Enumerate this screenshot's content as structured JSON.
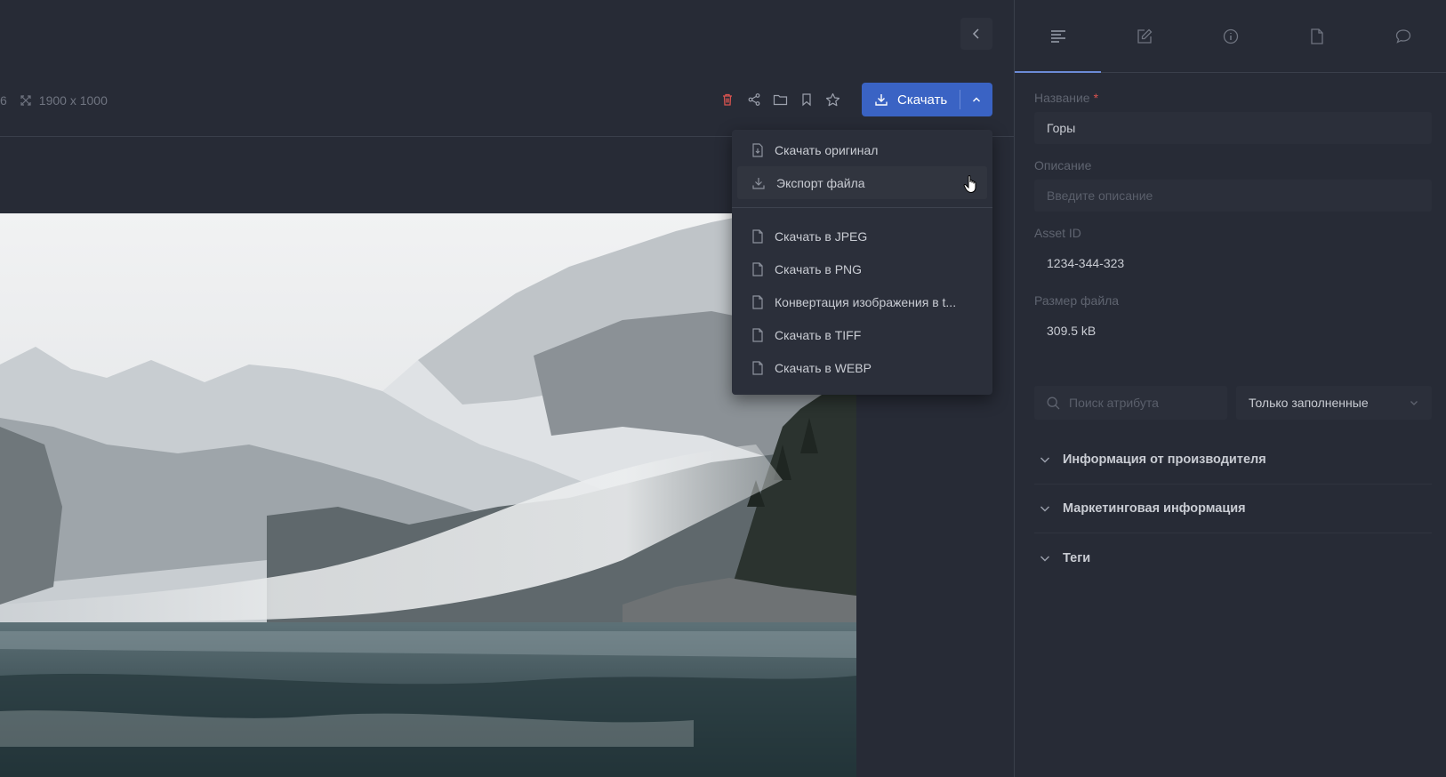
{
  "toolbar": {
    "dimensions": "1900 x 1000",
    "dim_prefix": "6",
    "download_label": "Скачать"
  },
  "download_menu": {
    "items_top": [
      {
        "label": "Скачать оригинал",
        "icon": "file-download-icon"
      },
      {
        "label": "Экспорт файла",
        "icon": "export-icon"
      }
    ],
    "items_formats": [
      {
        "label": "Скачать в JPEG",
        "icon": "file-icon"
      },
      {
        "label": "Скачать в PNG",
        "icon": "file-icon"
      },
      {
        "label": "Конвертация изображения в t...",
        "icon": "file-icon"
      },
      {
        "label": "Скачать в TIFF",
        "icon": "file-icon"
      },
      {
        "label": "Скачать в WEBP",
        "icon": "file-icon"
      }
    ]
  },
  "panel": {
    "fields": {
      "name_label": "Название",
      "name_required": "*",
      "name_value": "Горы",
      "description_label": "Описание",
      "description_placeholder": "Введите описание",
      "asset_id_label": "Asset ID",
      "asset_id_value": "1234-344-323",
      "file_size_label": "Размер файла",
      "file_size_value": "309.5 kB"
    },
    "filters": {
      "search_placeholder": "Поиск атрибута",
      "select_value": "Только заполненные"
    },
    "sections": [
      "Информация от производителя",
      "Маркетинговая информация",
      "Теги"
    ]
  },
  "colors": {
    "background": "#272b36",
    "accent": "#3a63c4",
    "danger": "#d9534f"
  }
}
